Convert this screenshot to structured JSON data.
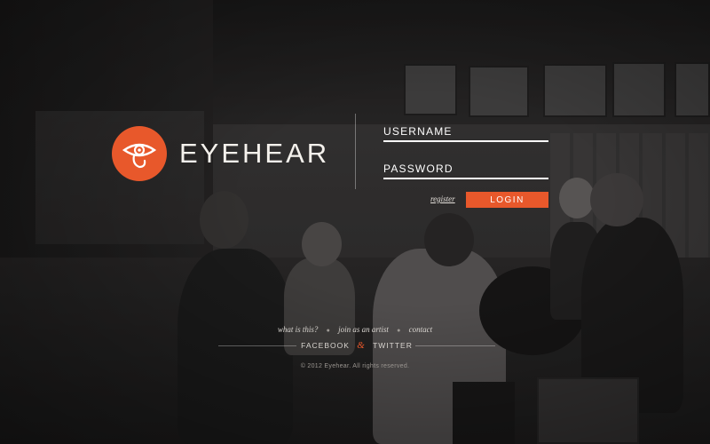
{
  "brand": {
    "name": "EYEHEAR",
    "logo_icon": "eye-ear-icon",
    "accent_color": "#e8582b"
  },
  "login_form": {
    "username_placeholder": "USERNAME",
    "password_placeholder": "PASSWORD",
    "register_label": "register",
    "login_label": "LOGIN"
  },
  "footer": {
    "links": [
      {
        "label": "what is this?"
      },
      {
        "label": "join as an artist"
      },
      {
        "label": "contact"
      }
    ],
    "social": {
      "facebook_label": "FACEBOOK",
      "separator": "&",
      "twitter_label": "TWITTER"
    },
    "copyright": "© 2012 Eyehear. All rights reserved."
  }
}
